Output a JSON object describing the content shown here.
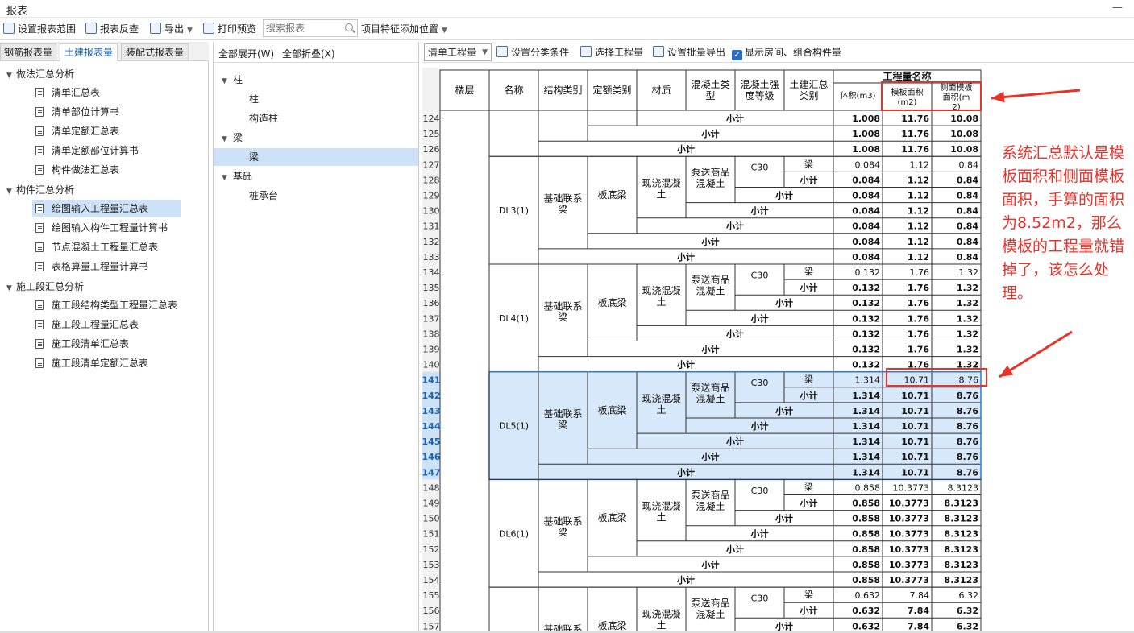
{
  "window": {
    "title": "报表",
    "minimize_label": "—"
  },
  "toolbar": {
    "set_range": "设置报表范围",
    "reverse_check": "报表反查",
    "export": "导出",
    "print_preview": "打印预览",
    "search_placeholder": "搜索报表",
    "feature_position": "项目特征添加位置"
  },
  "tabs": [
    {
      "label": "钢筋报表量"
    },
    {
      "label": "土建报表量"
    },
    {
      "label": "装配式报表量"
    }
  ],
  "tree": {
    "groups": [
      {
        "label": "做法汇总分析",
        "items": [
          "清单汇总表",
          "清单部位计算书",
          "清单定额汇总表",
          "清单定额部位计算书",
          "构件做法汇总表"
        ]
      },
      {
        "label": "构件汇总分析",
        "items": [
          "绘图输入工程量汇总表",
          "绘图输入构件工程量计算书",
          "节点混凝土工程量汇总表",
          "表格算量工程量计算书"
        ]
      },
      {
        "label": "施工段汇总分析",
        "items": [
          "施工段结构类型工程量汇总表",
          "施工段工程量汇总表",
          "施工段清单汇总表",
          "施工段清单定额汇总表"
        ]
      }
    ]
  },
  "middle": {
    "expand_all": "全部展开(W)",
    "collapse_all": "全部折叠(X)",
    "nodes": [
      {
        "label": "柱",
        "level": 0
      },
      {
        "label": "柱",
        "level": 1
      },
      {
        "label": "构造柱",
        "level": 1
      },
      {
        "label": "梁",
        "level": 0
      },
      {
        "label": "梁",
        "level": 1
      },
      {
        "label": "基础",
        "level": 0
      },
      {
        "label": "桩承台",
        "level": 1
      }
    ]
  },
  "right_toolbar": {
    "qty_select": "清单工程量",
    "set_category": "设置分类条件",
    "select_qty": "选择工程量",
    "batch_export": "设置批量导出",
    "show_rooms": "显示房间、组合构件量"
  },
  "table": {
    "headers": {
      "floor": "楼层",
      "name": "名称",
      "struct": "结构类别",
      "quota": "定额类别",
      "material": "材质",
      "concrete_type": "混凝土类型",
      "strength": "混凝土强度等级",
      "civil": "土建汇总类别",
      "group": "工程量名称",
      "volume": "体积(m3)",
      "formwork": "模板面积(m2)",
      "side_formwork": "侧面模板面积(m2)"
    },
    "subtotal": "小计",
    "struct_label": "基础联系梁",
    "quota_label": "板底梁",
    "material_label": "现浇混凝土",
    "conc_label": "泵送商品混凝土",
    "grade_label": "C30",
    "beam_label": "梁",
    "top_rows": [
      {
        "no": "124",
        "v": "1.008",
        "f": "11.76",
        "s": "10.08"
      },
      {
        "no": "125",
        "v": "1.008",
        "f": "11.76",
        "s": "10.08"
      },
      {
        "no": "126",
        "v": "1.008",
        "f": "11.76",
        "s": "10.08"
      }
    ],
    "blocks": [
      {
        "name": "DL3(1)",
        "start": 127,
        "v": "0.084",
        "f": "1.12",
        "s": "0.84"
      },
      {
        "name": "DL4(1)",
        "start": 134,
        "v": "0.132",
        "f": "1.76",
        "s": "1.32"
      },
      {
        "name": "DL5(1)",
        "start": 141,
        "v": "1.314",
        "f": "10.71",
        "s": "8.76"
      },
      {
        "name": "DL6(1)",
        "start": 148,
        "v": "0.858",
        "f": "10.3773",
        "s": "8.3123"
      },
      {
        "name": "",
        "start": 155,
        "v": "0.632",
        "f": "7.84",
        "s": "6.32"
      }
    ],
    "selected_block": "DL5(1)"
  },
  "annotation": {
    "text": "系统汇总默认是模板面积和侧面模板面积，手算的面积为8.52m2，那么模板的工程量就错掉了，该怎么处理。",
    "color": "#e8322a"
  },
  "colors": {
    "accent": "#1a62b8",
    "selection": "#cde2f6",
    "highlight": "#e8322a"
  }
}
